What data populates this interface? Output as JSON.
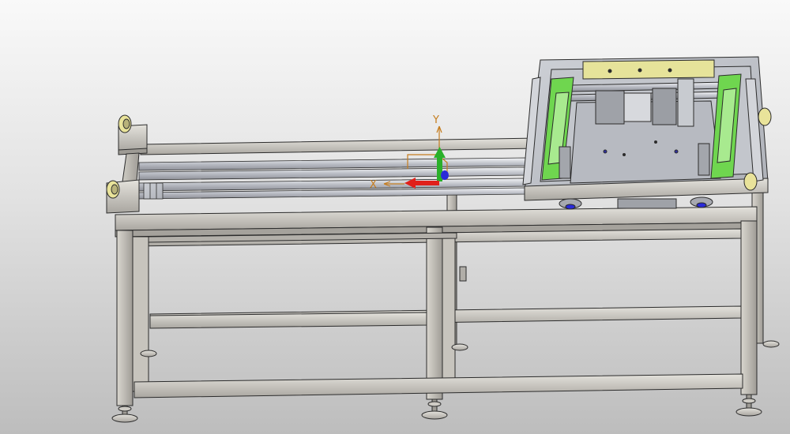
{
  "viewport": {
    "background_top": "#f9f9f9",
    "background_bottom": "#bdbdbd"
  },
  "triad": {
    "x_label": "X",
    "y_label": "Y",
    "x_color": "#e0201a",
    "y_color": "#2ab02a",
    "z_color": "#2a2ad8",
    "origin_color": "#c57d1f"
  },
  "model": {
    "frame_color": "#bdbab3",
    "edge_color": "#2c2c2c",
    "belt_color": "#6fd64f",
    "guard_bar_color": "#e6e39a",
    "bumper_color": "#e9e39a"
  },
  "icons": [
    "coordinate-triad-icon"
  ]
}
